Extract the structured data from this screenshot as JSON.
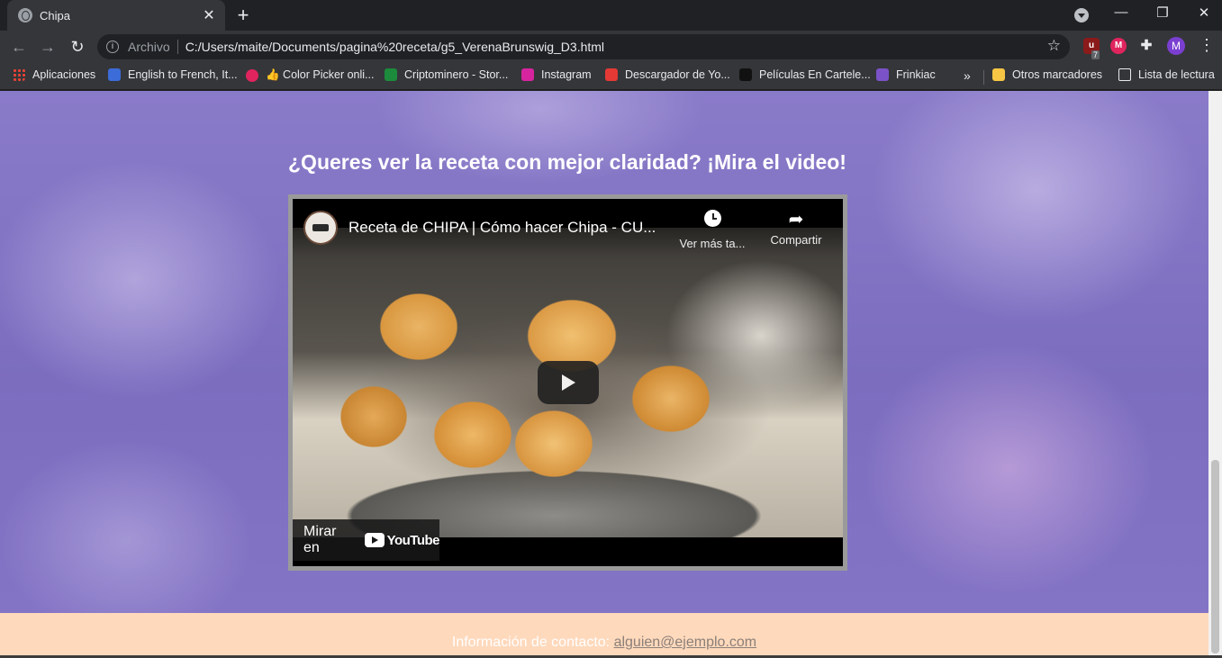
{
  "browser": {
    "tab": {
      "title": "Chipa"
    },
    "new_tab_symbol": "+",
    "window_controls": {
      "minimize": "—",
      "restore": "❐",
      "close": "✕"
    },
    "omnibox": {
      "scheme_label": "Archivo",
      "url": "C:/Users/maite/Documents/pagina%20receta/g5_VerenaBrunswig_D3.html"
    },
    "extensions": {
      "ublock_badge": "7",
      "profile_initial": "M"
    },
    "bookmarks": [
      {
        "label": "Aplicaciones",
        "icon": "apps-grid-icon",
        "color": "#ea4335"
      },
      {
        "label": "English to French, It...",
        "icon": "reverso-icon",
        "color": "#3b6cd8"
      },
      {
        "label": "👍 Color Picker onli...",
        "icon": "color-picker-icon",
        "color": "#e0245e"
      },
      {
        "label": "Criptominero - Stor...",
        "icon": "bolt-icon",
        "color": "#1c8c3c"
      },
      {
        "label": "Instagram",
        "icon": "instagram-icon",
        "color": "#d6249f"
      },
      {
        "label": "Descargador de Yo...",
        "icon": "download-icon",
        "color": "#e53935"
      },
      {
        "label": "Películas En Cartele...",
        "icon": "dots-icon",
        "color": "#111111"
      },
      {
        "label": "Frinkiac",
        "icon": "frinkiac-icon",
        "color": "#7b52c7"
      }
    ],
    "bookmarks_overflow": "»",
    "other_bookmarks": {
      "label": "Otros marcadores",
      "icon": "folder-icon",
      "color": "#f6c644"
    },
    "reading_list": {
      "label": "Lista de lectura",
      "icon": "reading-list-icon"
    }
  },
  "page": {
    "heading": "¿Queres ver la receta con mejor claridad? ¡Mira el video!",
    "video": {
      "title": "Receta de CHIPA | Cómo hacer Chipa - CU...",
      "watch_later": "Ver más ta...",
      "share": "Compartir",
      "watch_on": "Mirar en",
      "youtube_wordmark": "YouTube"
    },
    "footer": {
      "contact_label": "Información de contacto:",
      "contact_email": "alguien@ejemplo.com"
    }
  },
  "colors": {
    "hero_purple": "#7c6dbf",
    "footer_peach": "#ffd9bc",
    "chrome_dark": "#202124",
    "chrome_toolbar": "#35363a"
  }
}
